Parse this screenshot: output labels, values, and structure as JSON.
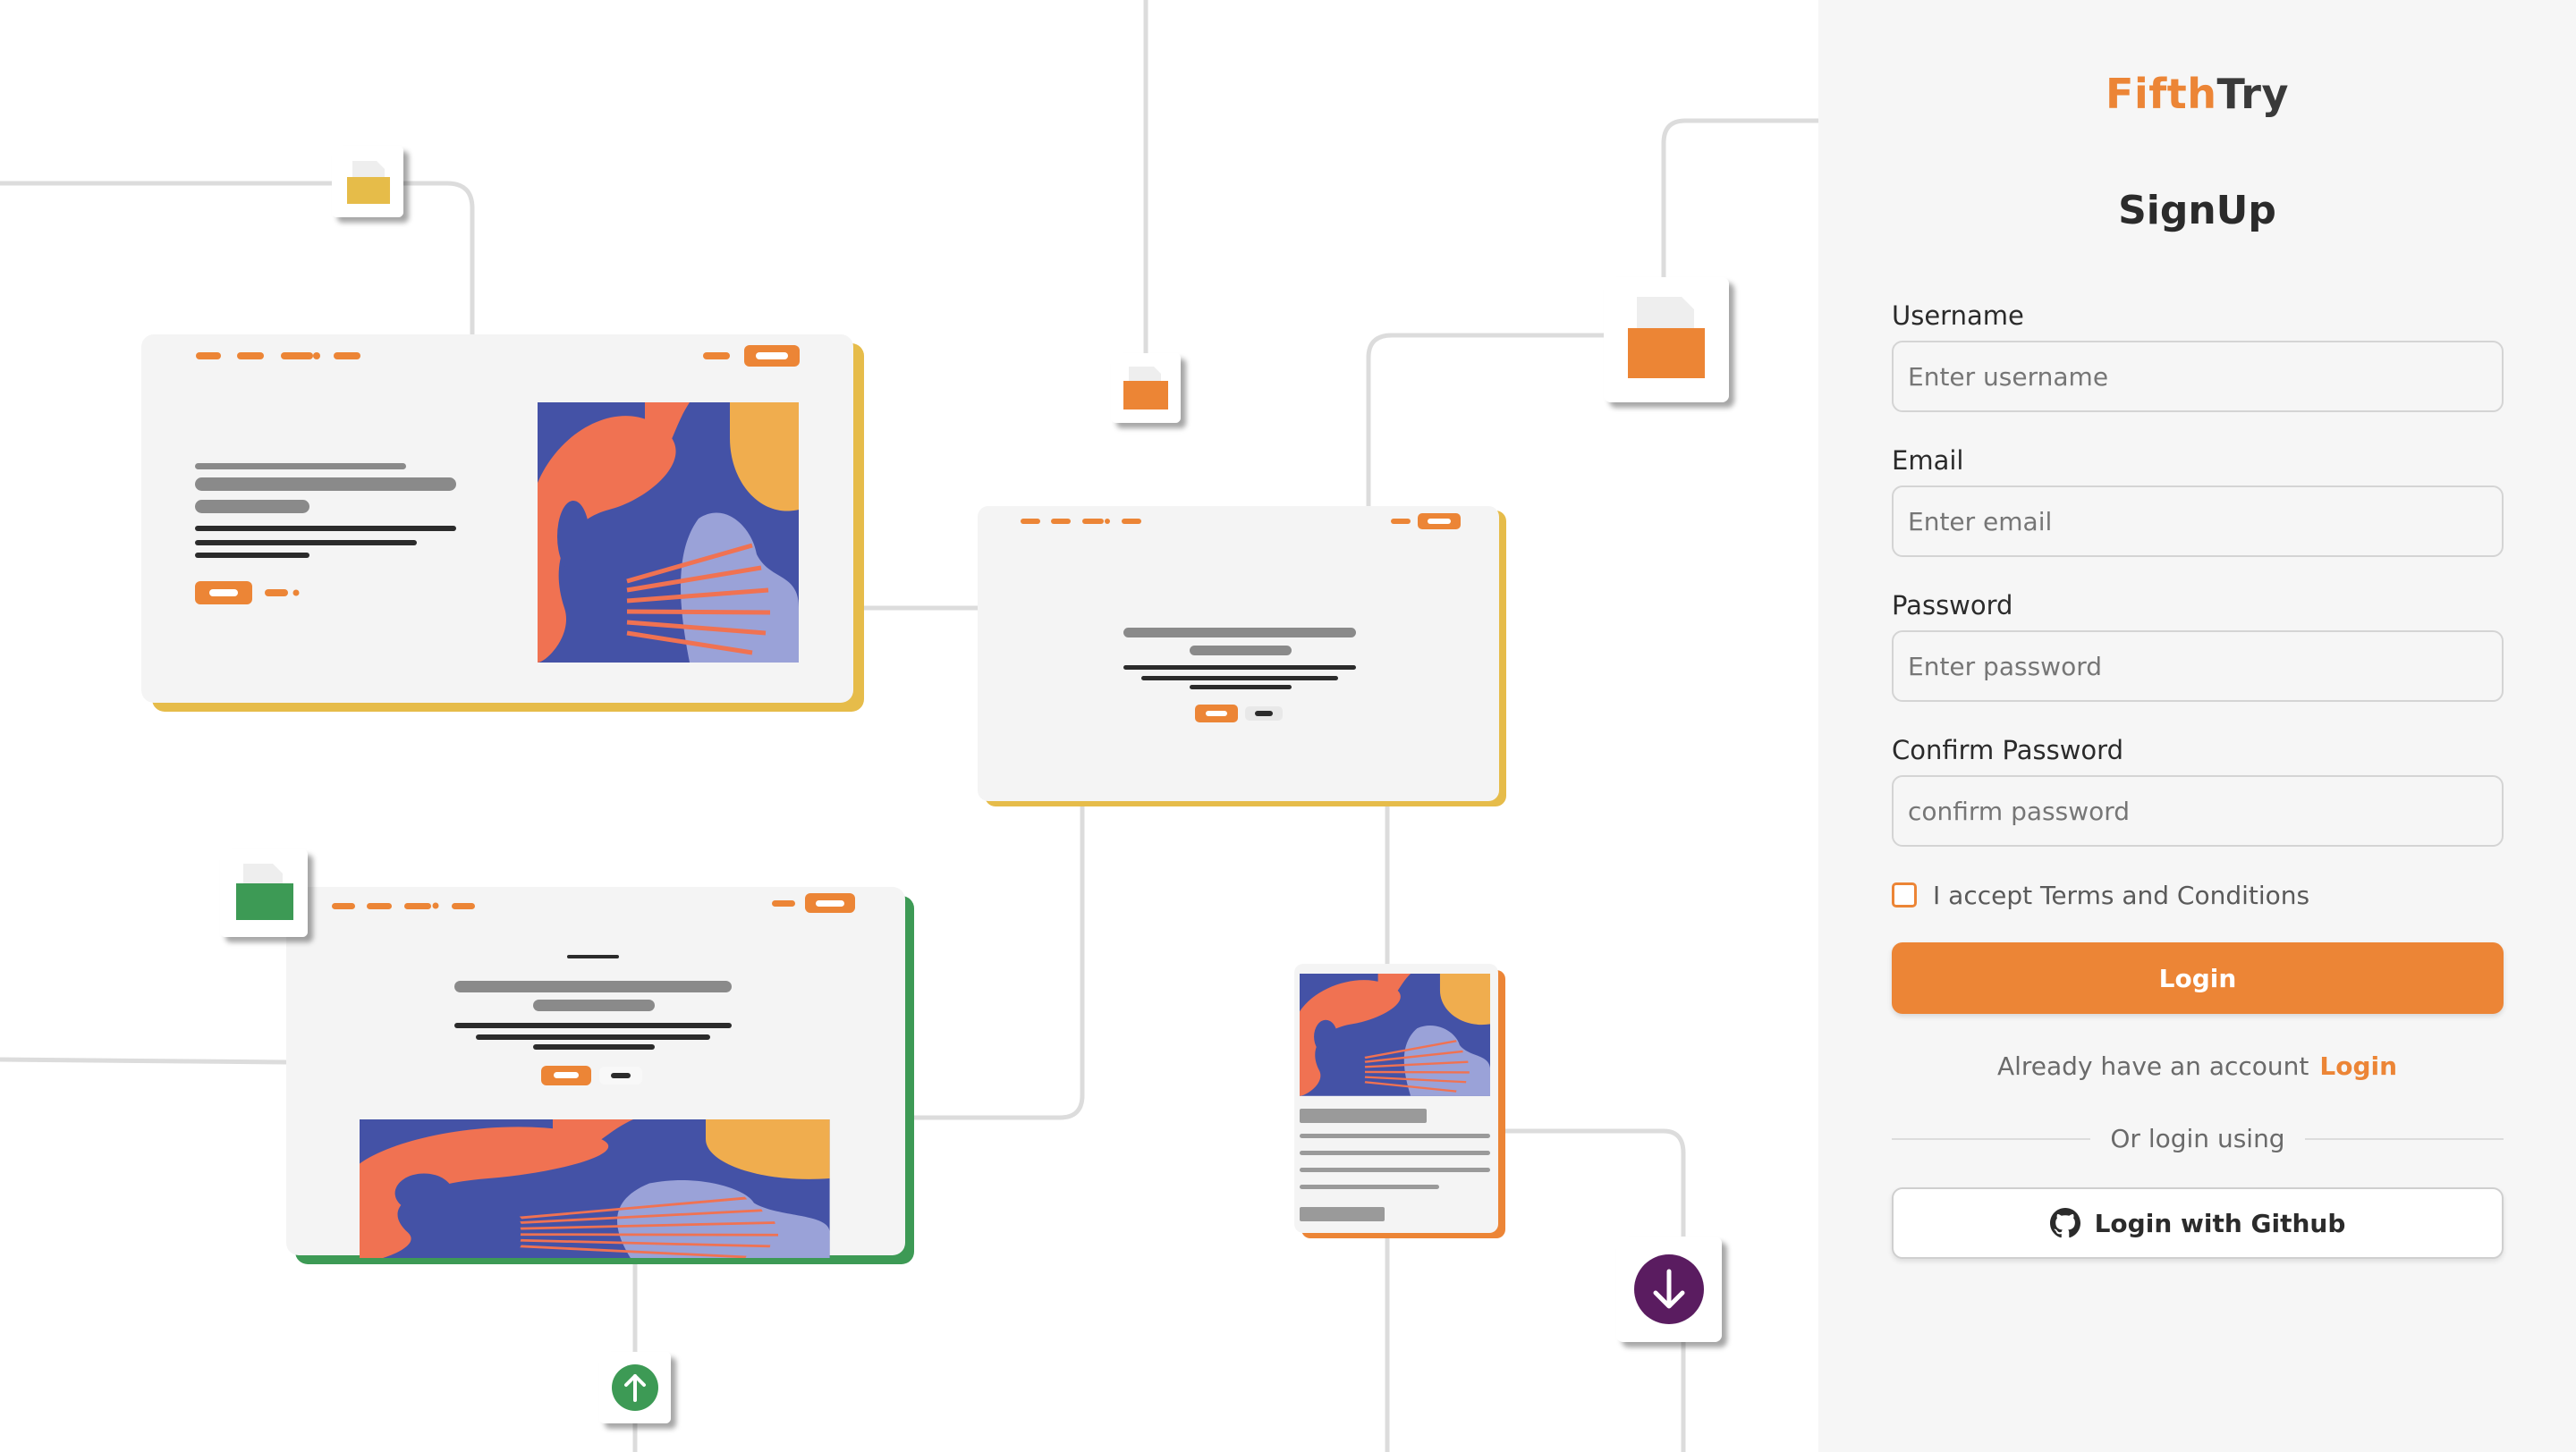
{
  "brand": {
    "part1": "Fifth",
    "part2": "Try"
  },
  "title": "SignUp",
  "fields": {
    "username": {
      "label": "Username",
      "placeholder": "Enter username"
    },
    "email": {
      "label": "Email",
      "placeholder": "Enter email"
    },
    "password": {
      "label": "Password",
      "placeholder": "Enter password"
    },
    "confirm": {
      "label": "Confirm Password",
      "placeholder": "confirm password"
    }
  },
  "terms": {
    "label": "I accept Terms and Conditions",
    "checked": false
  },
  "login_button": "Login",
  "already": {
    "text": "Already have an account",
    "link": "Login"
  },
  "or_text": "Or login using",
  "github_button": {
    "label": "Login with Github",
    "icon": "github-icon"
  },
  "colors": {
    "accent": "#ec8536",
    "panel_bg": "#f6f6f6",
    "text": "#2b2b2b",
    "card_yellow": "#e6bc4a",
    "card_green": "#3d9a55",
    "art_blue": "#4452a6",
    "art_coral": "#f07252",
    "art_lavender": "#9aa2d8",
    "art_gold": "#f0ad4e",
    "icon_purple": "#5a1f60"
  },
  "illustration_icons": [
    "folder-icon",
    "arrow-up-icon",
    "arrow-down-icon"
  ]
}
